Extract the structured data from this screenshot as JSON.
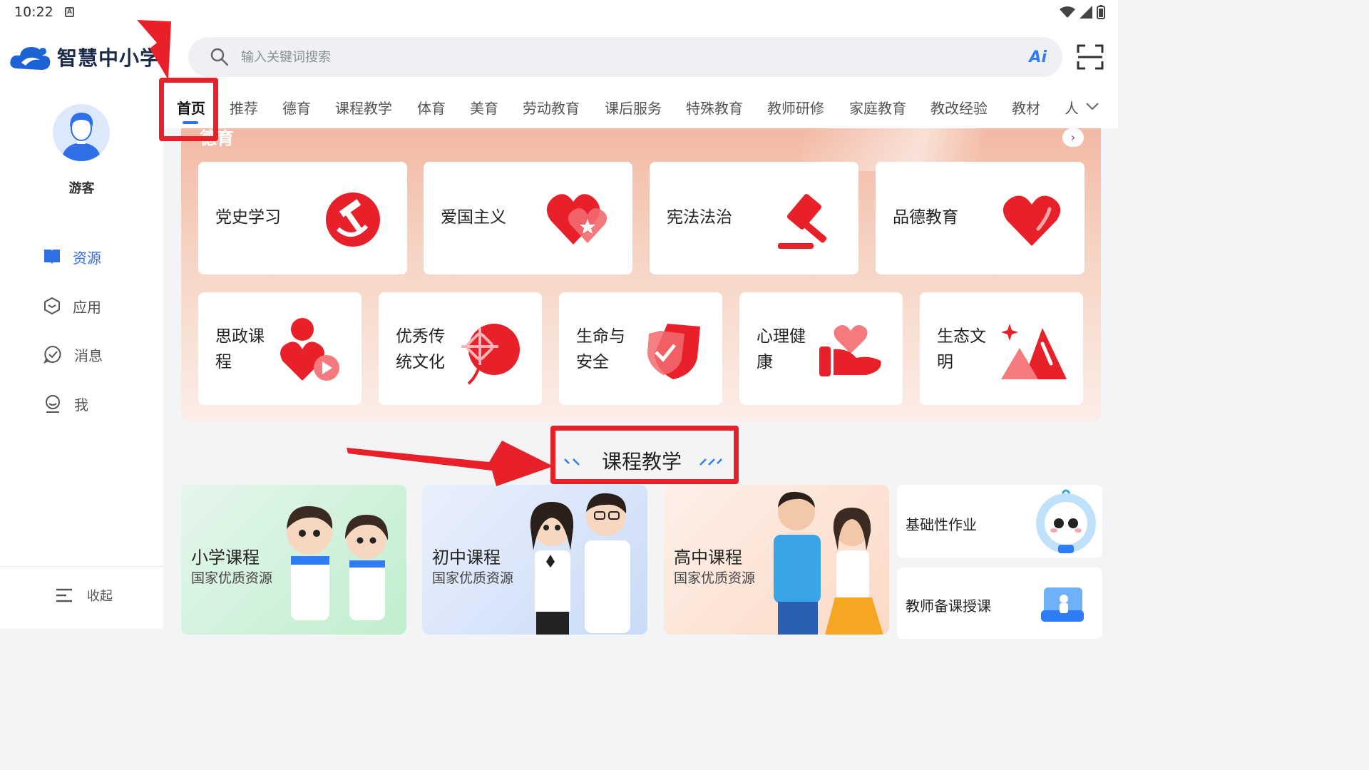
{
  "status_bar": {
    "time": "10:22",
    "indicator": "A"
  },
  "header": {
    "logo_text": "智慧中小学",
    "search_placeholder": "输入关键词搜索",
    "ai_label": "Ai"
  },
  "sidebar": {
    "username": "游客",
    "items": [
      {
        "label": "资源",
        "icon": "book-icon",
        "active": true
      },
      {
        "label": "应用",
        "icon": "cube-icon",
        "active": false
      },
      {
        "label": "消息",
        "icon": "chat-check-icon",
        "active": false
      },
      {
        "label": "我",
        "icon": "user-outline-icon",
        "active": false
      }
    ],
    "collapse_label": "收起"
  },
  "tabs": [
    "首页",
    "推荐",
    "德育",
    "课程教学",
    "体育",
    "美育",
    "劳动教育",
    "课后服务",
    "特殊教育",
    "教师研修",
    "家庭教育",
    "教改经验",
    "教材",
    "人"
  ],
  "active_tab": "首页",
  "moral_section": {
    "title": "德育",
    "top_cards": [
      {
        "label": "党史学习",
        "icon": "hammer-sickle-icon"
      },
      {
        "label": "爱国主义",
        "icon": "heart-star-icon"
      },
      {
        "label": "宪法法治",
        "icon": "gavel-icon"
      },
      {
        "label": "品德教育",
        "icon": "heart-icon"
      }
    ],
    "bottom_cards": [
      {
        "line1": "思政课",
        "line2": "程",
        "icon": "person-heart-play-icon"
      },
      {
        "line1": "优秀传",
        "line2": "统文化",
        "icon": "chinese-knot-icon"
      },
      {
        "line1": "生命与",
        "line2": "安全",
        "icon": "shield-check-icon"
      },
      {
        "line1": "心理健",
        "line2": "康",
        "icon": "hand-heart-icon"
      },
      {
        "line1": "生态文",
        "line2": "明",
        "icon": "mountain-star-icon"
      }
    ]
  },
  "course_section": {
    "title": "课程教学",
    "cards": [
      {
        "title": "小学课程",
        "subtitle": "国家优质资源"
      },
      {
        "title": "初中课程",
        "subtitle": "国家优质资源"
      },
      {
        "title": "高中课程",
        "subtitle": "国家优质资源"
      }
    ],
    "side_cards": [
      {
        "label": "基础性作业",
        "icon": "mascot-icon"
      },
      {
        "label": "教师备课授课",
        "icon": "teacher-board-icon"
      }
    ]
  },
  "colors": {
    "accent": "#2f6fe8",
    "annotation": "#e8202a",
    "moral_red": "#e8202a"
  }
}
